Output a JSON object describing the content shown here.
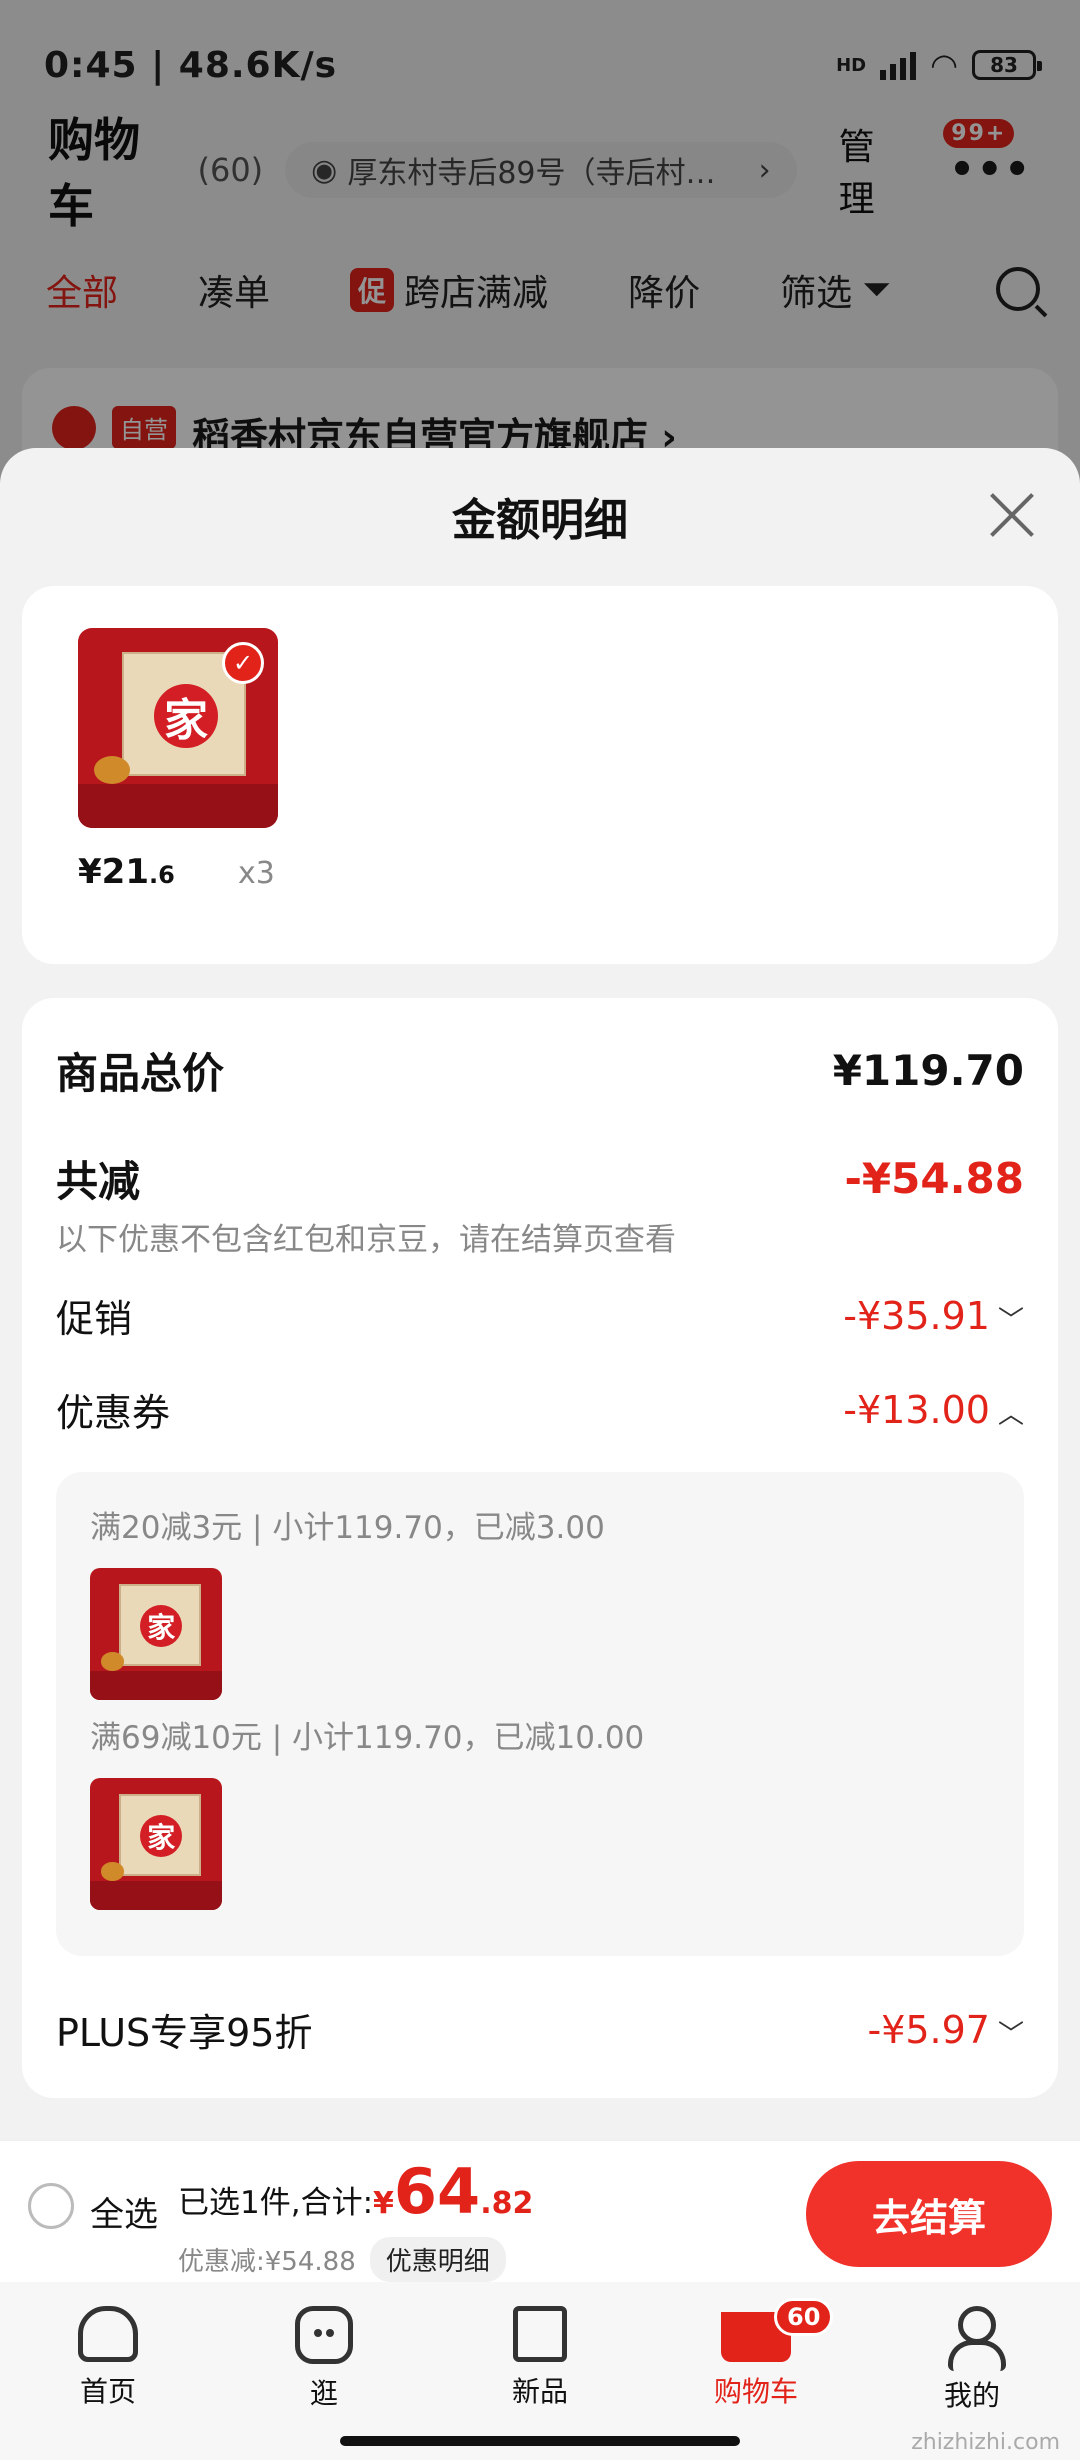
{
  "status_bar": {
    "time": "0:45",
    "speed": "48.6K/s",
    "battery": "83",
    "network": "HD"
  },
  "header": {
    "title": "购物车",
    "count": "(60)",
    "address": "厚东村寺后89号（寺后村…",
    "manage": "管理",
    "more_badge": "99+"
  },
  "filter_tabs": {
    "all": "全部",
    "combine": "凑单",
    "promo_badge": "促",
    "cross_store": "跨店满减",
    "price_drop": "降价",
    "filter": "筛选"
  },
  "store": {
    "tag": "自营",
    "name": "稻香村京东自营官方旗舰店 ›"
  },
  "sheet": {
    "title": "金额明细",
    "product": {
      "price_int": "¥21",
      "price_dec": ".6",
      "qty": "x3",
      "seal_char": "家"
    },
    "total_label": "商品总价",
    "total_value": "¥119.70",
    "reduce_label": "共减",
    "reduce_value": "-¥54.88",
    "note": "以下优惠不包含红包和京豆，请在结算页查看",
    "promo_label": "促销",
    "promo_value": "-¥35.91",
    "coupon_label": "优惠券",
    "coupon_value": "-¥13.00",
    "coupons": [
      {
        "desc": "满20减3元 | 小计119.70，已减3.00"
      },
      {
        "desc": "满69减10元 | 小计119.70，已减10.00"
      }
    ],
    "plus_label": "PLUS专享95折",
    "plus_value": "-¥5.97"
  },
  "checkout": {
    "select_all": "全选",
    "summary_prefix": "已选1件,合计:",
    "currency": "¥",
    "amount_int": "64",
    "amount_dec": ".82",
    "saved": "优惠减:¥54.88",
    "detail_link": "优惠明细",
    "button": "去结算"
  },
  "tabs": [
    {
      "label": "首页",
      "icon": "home-icon"
    },
    {
      "label": "逛",
      "icon": "browse-icon"
    },
    {
      "label": "新品",
      "icon": "cube-icon"
    },
    {
      "label": "购物车",
      "icon": "cart-icon",
      "badge": "60"
    },
    {
      "label": "我的",
      "icon": "user-icon"
    }
  ],
  "colors": {
    "accent": "#e2231a",
    "checkout_button": "#f0322b"
  },
  "watermark": "zhizhizhi.com"
}
